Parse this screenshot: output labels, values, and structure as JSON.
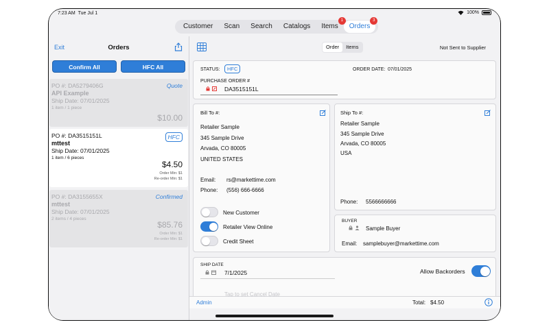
{
  "statusbar": {
    "time": "7:23 AM",
    "date": "Tue Jul 1",
    "battery": "100%"
  },
  "topnav": {
    "tabs": [
      {
        "label": "Customer"
      },
      {
        "label": "Scan"
      },
      {
        "label": "Search"
      },
      {
        "label": "Catalogs"
      },
      {
        "label": "Items",
        "badge": "1"
      },
      {
        "label": "Orders",
        "badge": "3",
        "active": true
      }
    ]
  },
  "leftpane": {
    "exit_label": "Exit",
    "title": "Orders",
    "confirm_all_label": "Confirm All",
    "hfc_all_label": "HFC All",
    "orders": [
      {
        "po": "PO #: DA5279406G",
        "name": "API Example",
        "ship": "Ship Date: 07/01/2025",
        "count": "1 item / 1 piece",
        "tag": "Quote",
        "total": "$10.00"
      },
      {
        "po": "PO #: DA3515151L",
        "name": "mttest",
        "ship": "Ship Date: 07/01/2025",
        "count": "1 item / 6 pieces",
        "tag": "HFC",
        "total": "$4.50",
        "order_min": "Order Min: $1",
        "reorder_min": "Re-order Min: $1"
      },
      {
        "po": "PO #: DA3155655X",
        "name": "mttest",
        "ship": "Ship Date: 07/01/2025",
        "count": "2 items / 4 pieces",
        "tag": "Confirmed",
        "total": "$85.76",
        "order_min": "Order Min: $1",
        "reorder_min": "Re-order Min: $1"
      }
    ]
  },
  "header": {
    "segment": [
      "Order",
      "Items"
    ],
    "status_text": "Not Sent to Supplier"
  },
  "order": {
    "status_label": "STATUS:",
    "status_value": "HFC",
    "order_date_label": "ORDER DATE:",
    "order_date": "07/01/2025",
    "po_label": "PURCHASE ORDER #",
    "po_value": "DA3515151L"
  },
  "bill_to": {
    "label": "Bill To #:",
    "name": "Retailer Sample",
    "street": "345 Sample Drive",
    "city": "Arvada, CO  80005",
    "country": "UNITED STATES",
    "email_label": "Email:",
    "email": "rs@markettime.com",
    "phone_label": "Phone:",
    "phone": "(556) 666-6666"
  },
  "toggles": [
    {
      "label": "New Customer",
      "on": false
    },
    {
      "label": "Retailer View Online",
      "on": true
    },
    {
      "label": "Credit Sheet",
      "on": false
    }
  ],
  "ship_to": {
    "label": "Ship To #:",
    "name": "Retailer Sample",
    "street": "345 Sample Drive",
    "city": "Arvada, CO  80005",
    "country": "USA",
    "phone_label": "Phone:",
    "phone": "5566666666"
  },
  "buyer": {
    "label": "BUYER",
    "name": "Sample Buyer",
    "email_label": "Email:",
    "email": "samplebuyer@markettime.com"
  },
  "ship": {
    "label": "SHIP DATE",
    "date": "7/1/2025",
    "backorders_label": "Allow Backorders",
    "cancel_placeholder": "Tap to set Cancel Date"
  },
  "footer": {
    "admin_label": "Admin",
    "total_label": "Total:",
    "total_value": "$4.50"
  },
  "colors": {
    "accent": "#2f7ed8",
    "badge": "#e53935"
  }
}
